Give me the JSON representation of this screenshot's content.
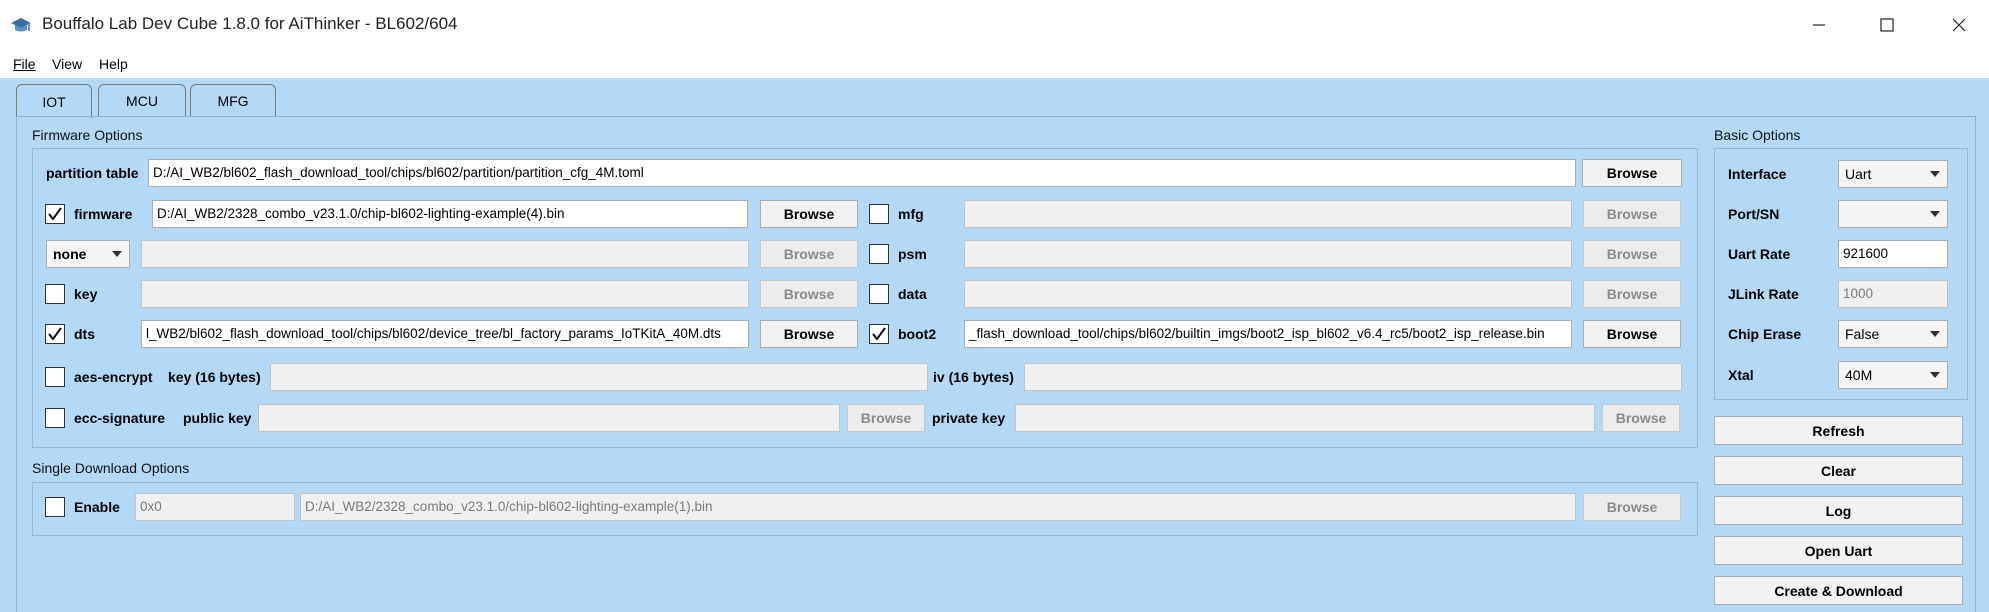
{
  "window": {
    "title": "Bouffalo Lab Dev Cube 1.8.0 for AiThinker - BL602/604",
    "icons": [
      "app-cap-icon",
      "minimize-icon",
      "maximize-icon",
      "close-icon"
    ]
  },
  "menu": {
    "file": "File",
    "view": "View",
    "help": "Help"
  },
  "tabs": {
    "iot": "IOT",
    "mcu": "MCU",
    "mfg": "MFG"
  },
  "firmware_options": {
    "title": "Firmware Options",
    "partition_table": {
      "label": "partition table",
      "value": "D:/AI_WB2/bl602_flash_download_tool/chips/bl602/partition/partition_cfg_4M.toml",
      "browse": "Browse"
    },
    "firmware": {
      "label": "firmware",
      "checked": true,
      "value": "D:/AI_WB2/2328_combo_v23.1.0/chip-bl602-lighting-example(4).bin",
      "browse": "Browse"
    },
    "mfg": {
      "label": "mfg",
      "checked": false,
      "value": "",
      "browse": "Browse"
    },
    "none_select": {
      "value": "none",
      "input": "",
      "browse": "Browse"
    },
    "psm": {
      "label": "psm",
      "checked": false,
      "value": "",
      "browse": "Browse"
    },
    "key": {
      "label": "key",
      "checked": false,
      "value": "",
      "browse": "Browse"
    },
    "data": {
      "label": "data",
      "checked": false,
      "value": "",
      "browse": "Browse"
    },
    "dts": {
      "label": "dts",
      "checked": true,
      "value": "l_WB2/bl602_flash_download_tool/chips/bl602/device_tree/bl_factory_params_IoTKitA_40M.dts",
      "browse": "Browse"
    },
    "boot2": {
      "label": "boot2",
      "checked": true,
      "value": "_flash_download_tool/chips/bl602/builtin_imgs/boot2_isp_bl602_v6.4_rc5/boot2_isp_release.bin",
      "browse": "Browse"
    },
    "aes_encrypt": {
      "label": "aes-encrypt",
      "checked": false,
      "key_label": "key (16 bytes)",
      "key_value": "",
      "iv_label": "iv (16 bytes)",
      "iv_value": ""
    },
    "ecc_signature": {
      "label": "ecc-signature",
      "checked": false,
      "public_label": "public key",
      "public_value": "",
      "public_browse": "Browse",
      "private_label": "private key",
      "private_value": "",
      "private_browse": "Browse"
    }
  },
  "single_download": {
    "title": "Single Download Options",
    "enable_label": "Enable",
    "checked": false,
    "address": "0x0",
    "file": "D:/AI_WB2/2328_combo_v23.1.0/chip-bl602-lighting-example(1).bin",
    "browse": "Browse"
  },
  "basic_options": {
    "title": "Basic Options",
    "interface": {
      "label": "Interface",
      "value": "Uart"
    },
    "port": {
      "label": "Port/SN",
      "value": ""
    },
    "uart_rate": {
      "label": "Uart Rate",
      "value": "921600"
    },
    "jlink_rate": {
      "label": "JLink Rate",
      "value": "1000"
    },
    "chip_erase": {
      "label": "Chip Erase",
      "value": "False"
    },
    "xtal": {
      "label": "Xtal",
      "value": "40M"
    }
  },
  "actions": {
    "refresh": "Refresh",
    "clear": "Clear",
    "log": "Log",
    "open_uart": "Open Uart",
    "create_download": "Create & Download"
  }
}
